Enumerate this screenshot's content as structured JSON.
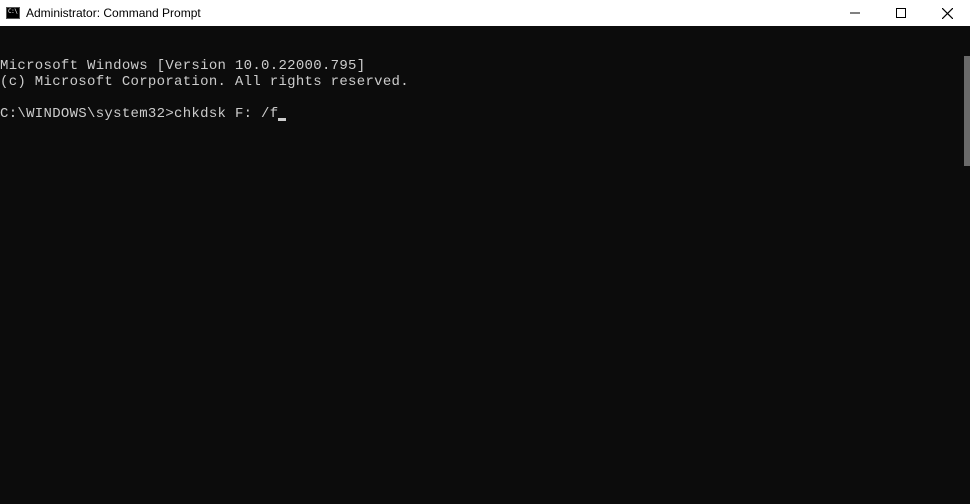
{
  "window": {
    "title": "Administrator: Command Prompt"
  },
  "terminal": {
    "line1": "Microsoft Windows [Version 10.0.22000.795]",
    "line2": "(c) Microsoft Corporation. All rights reserved.",
    "prompt": "C:\\WINDOWS\\system32>",
    "command": "chkdsk F: /f"
  }
}
